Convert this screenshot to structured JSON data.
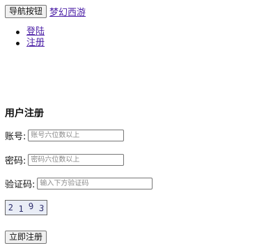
{
  "nav": {
    "toggle_label": "导航按钮",
    "brand": "梦幻西游",
    "links": [
      "登陆",
      "注册"
    ]
  },
  "form": {
    "title": "用户注册",
    "account_label": "账号:",
    "account_placeholder": "账号六位数以上",
    "password_label": "密码:",
    "password_placeholder": "密码六位数以上",
    "captcha_label": "验证码:",
    "captcha_placeholder": "输入下方验证码",
    "captcha_chars": [
      "2",
      "1",
      "9",
      "3"
    ],
    "submit_label": "立即注册"
  }
}
